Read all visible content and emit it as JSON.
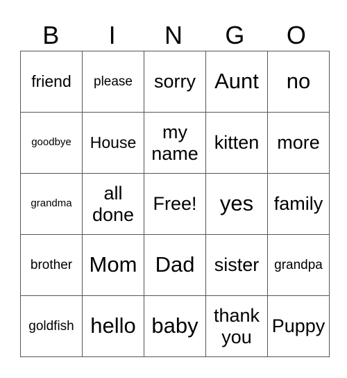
{
  "header": [
    "B",
    "I",
    "N",
    "G",
    "O"
  ],
  "cells": [
    [
      "friend",
      "please",
      "sorry",
      "Aunt",
      "no"
    ],
    [
      "goodbye",
      "House",
      "my name",
      "kitten",
      "more"
    ],
    [
      "grandma",
      "all done",
      "Free!",
      "yes",
      "family"
    ],
    [
      "brother",
      "Mom",
      "Dad",
      "sister",
      "grandpa"
    ],
    [
      "goldfish",
      "hello",
      "baby",
      "thank you",
      "Puppy"
    ]
  ]
}
